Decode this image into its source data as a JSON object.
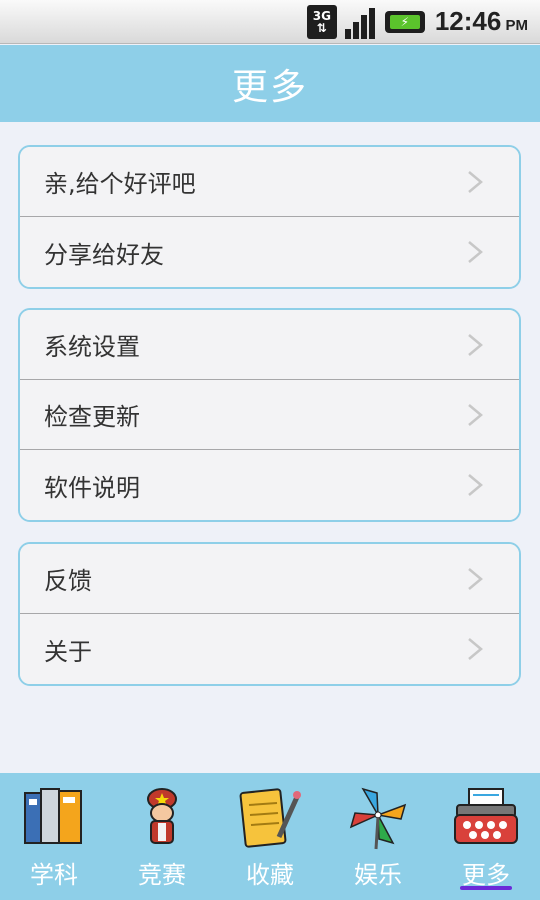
{
  "status_bar": {
    "network": "3G",
    "time": "12:46",
    "ampm": "PM"
  },
  "header": {
    "title": "更多"
  },
  "groups": [
    {
      "items": [
        {
          "label": "亲,给个好评吧"
        },
        {
          "label": "分享给好友"
        }
      ]
    },
    {
      "items": [
        {
          "label": "系统设置"
        },
        {
          "label": "检查更新"
        },
        {
          "label": "软件说明"
        }
      ]
    },
    {
      "items": [
        {
          "label": "反馈"
        },
        {
          "label": "关于"
        }
      ]
    }
  ],
  "bottom_nav": {
    "items": [
      {
        "label": "学科",
        "icon": "books-icon"
      },
      {
        "label": "竞赛",
        "icon": "soldier-icon"
      },
      {
        "label": "收藏",
        "icon": "notepad-pencil-icon"
      },
      {
        "label": "娱乐",
        "icon": "pinwheel-icon"
      },
      {
        "label": "更多",
        "icon": "typewriter-icon"
      }
    ],
    "active_index": 4
  },
  "colors": {
    "accent": "#8ecfe8",
    "background": "#eef1f8",
    "active_underline": "#6b2bd8"
  }
}
